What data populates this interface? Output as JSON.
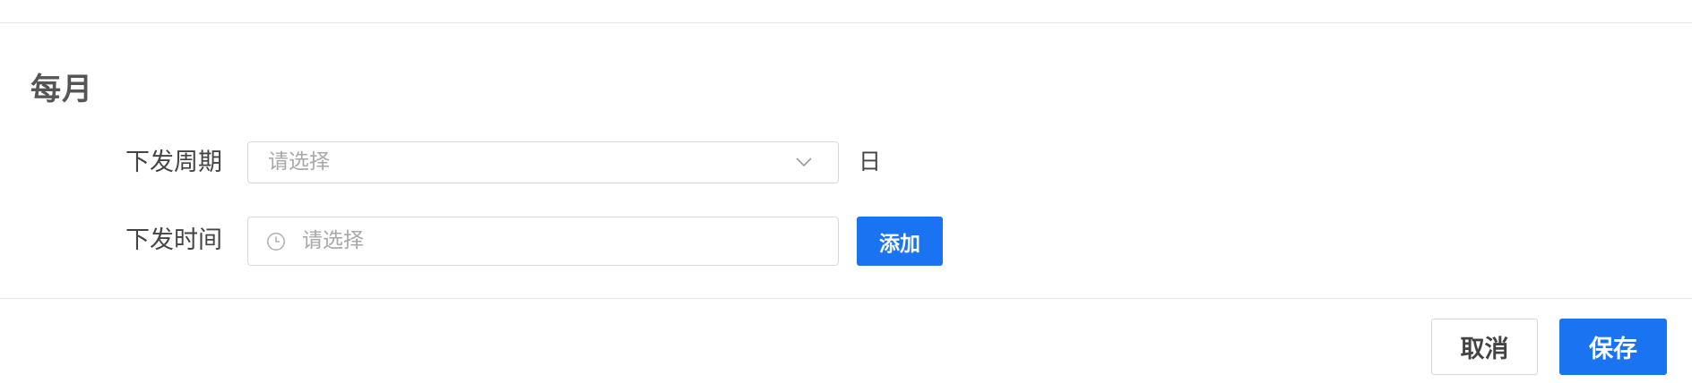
{
  "section": {
    "title": "每月"
  },
  "form": {
    "cycle": {
      "label": "下发周期",
      "placeholder": "请选择",
      "unit": "日"
    },
    "time": {
      "label": "下发时间",
      "placeholder": "请选择",
      "add_label": "添加"
    }
  },
  "footer": {
    "cancel_label": "取消",
    "save_label": "保存"
  },
  "icons": {
    "select_arrow": "chevron-down-icon",
    "time_prefix": "clock-icon"
  },
  "colors": {
    "primary": "#1a73f0",
    "border": "#d9d9d9",
    "placeholder": "#a8a8a8"
  }
}
